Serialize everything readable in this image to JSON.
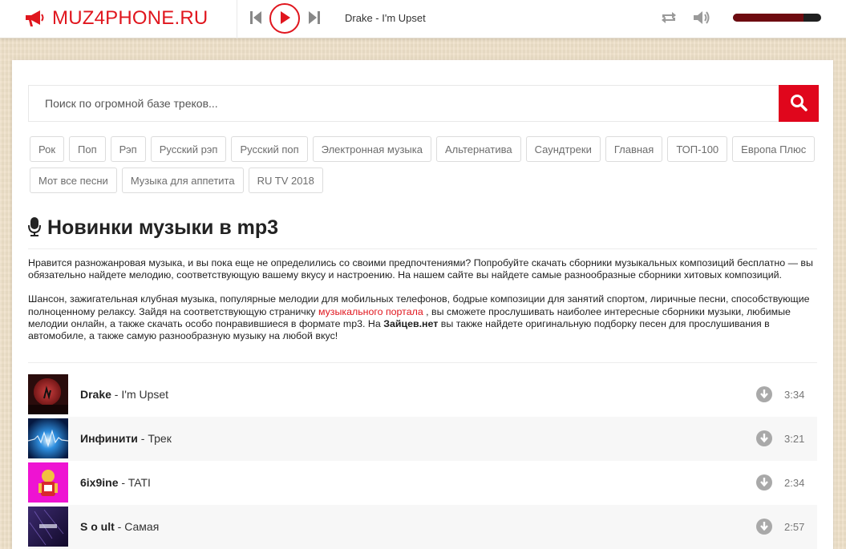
{
  "header": {
    "logo_text": "MUZ4PHONE.RU",
    "now_playing": "Drake - I'm Upset",
    "volume_level": 0.8,
    "icons": {
      "logo": "megaphone-icon",
      "prev": "skip-back-icon",
      "play": "play-icon",
      "next": "skip-forward-icon",
      "repeat": "repeat-icon",
      "volume": "speaker-icon"
    },
    "accent_color": "#e0161e"
  },
  "search": {
    "placeholder": "Поиск по огромной базе треков...",
    "value": "",
    "button_icon": "search-icon"
  },
  "tags": [
    "Рок",
    "Поп",
    "Рэп",
    "Русский рэп",
    "Русский поп",
    "Электронная музыка",
    "Альтернатива",
    "Саундтреки",
    "Главная",
    "ТОП-100",
    "Европа Плюс",
    "Мот все песни",
    "Музыка для аппетита",
    "RU TV 2018"
  ],
  "section": {
    "title": "Новинки музыки в mp3",
    "title_icon": "microphone-icon"
  },
  "description": {
    "p1": "Нравится разножанровая музыка, и вы пока еще не определились со своими предпочтениями? Попробуйте скачать сборники музыкальных композиций бесплатно — вы обязательно найдете мелодию, соответствующую вашему вкусу и настроению. На нашем сайте вы найдете самые разнообразные сборники хитовых композиций.",
    "p2_a": "Шансон, зажигательная клубная музыка, популярные мелодии для мобильных телефонов, бодрые композиции для занятий спортом, лиричные песни, способствующие полноценному релаксу. Зайдя на соответствующую страничку ",
    "p2_link": "музыкального портала",
    "p2_b": " , вы сможете прослушивать наиболее интересные сборники музыки, любимые мелодии онлайн, а также скачать особо понравившиеся в формате mp3. На ",
    "p2_bold": "Зайцев.нет",
    "p2_c": " вы также найдете оригинальную подборку песен для прослушивания в автомобиле, а также самую разнообразную музыку на любой вкус!"
  },
  "tracks": [
    {
      "artist": "Drake",
      "sep": " - ",
      "title": "I'm Upset",
      "duration": "3:34",
      "download_icon": "download-icon"
    },
    {
      "artist": "Инфинити",
      "sep": " - ",
      "title": "Трек",
      "duration": "3:21",
      "download_icon": "download-icon"
    },
    {
      "artist": "6ix9ine",
      "sep": " - ",
      "title": "TATI",
      "duration": "2:34",
      "download_icon": "download-icon"
    },
    {
      "artist": "S o ult",
      "sep": " - ",
      "title": "Самая",
      "duration": "2:57",
      "download_icon": "download-icon"
    }
  ]
}
